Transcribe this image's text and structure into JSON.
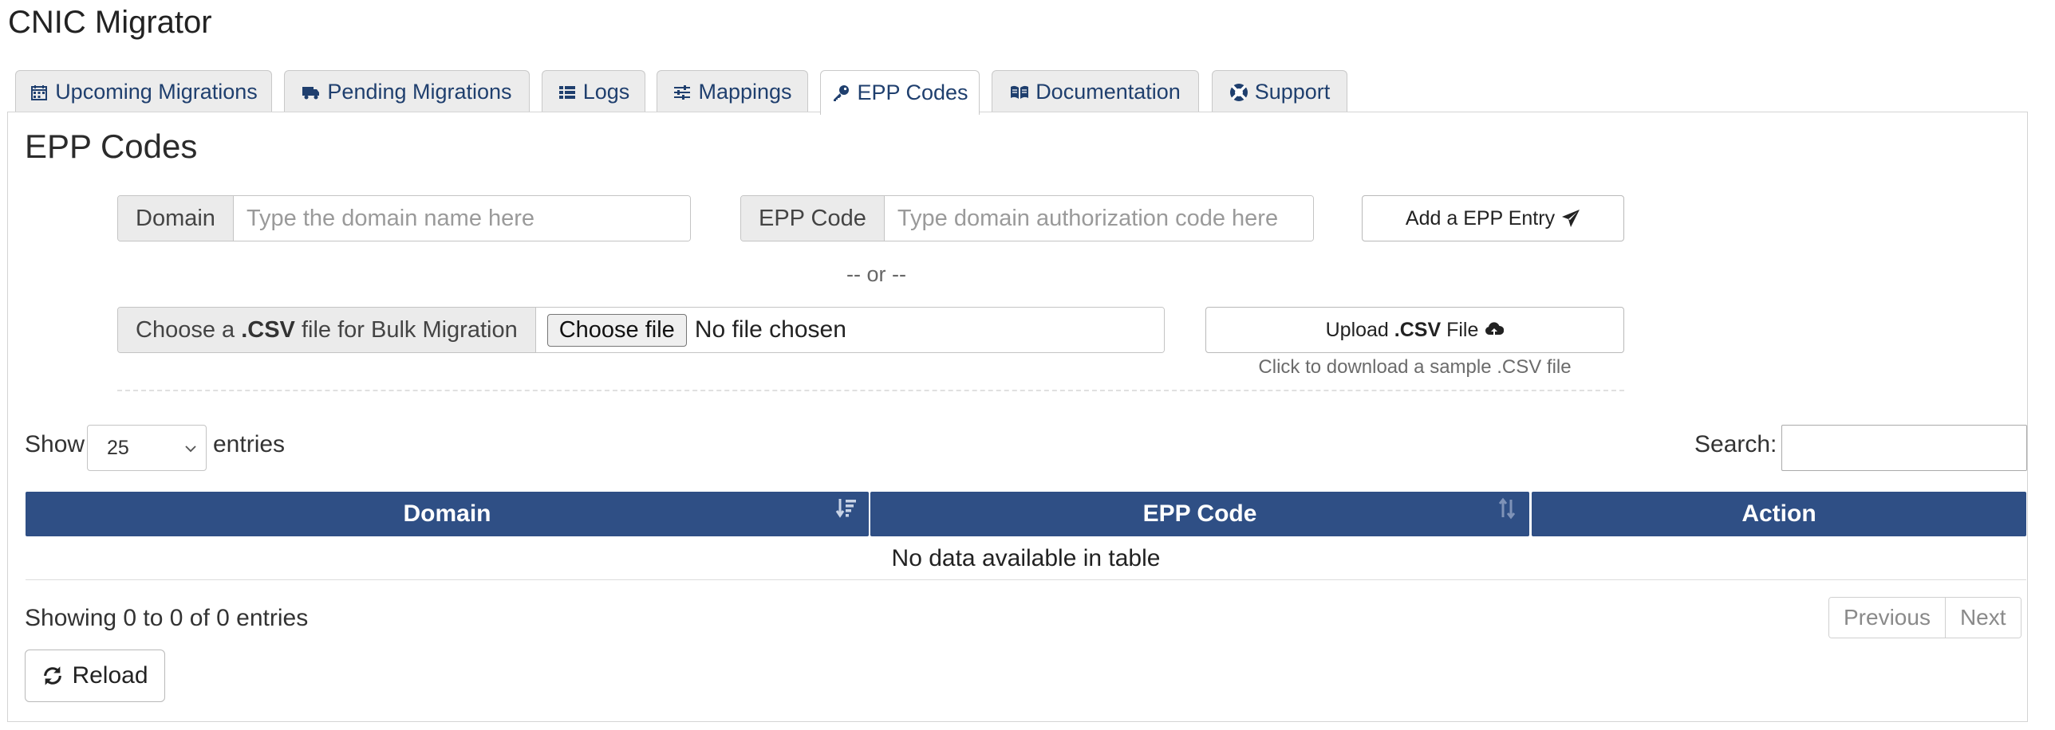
{
  "app": {
    "title": "CNIC Migrator"
  },
  "tabs": [
    {
      "label": "Upcoming Migrations",
      "icon": "calendar-icon",
      "active": false
    },
    {
      "label": "Pending Migrations",
      "icon": "truck-icon",
      "active": false
    },
    {
      "label": "Logs",
      "icon": "list-icon",
      "active": false
    },
    {
      "label": "Mappings",
      "icon": "sliders-icon",
      "active": false
    },
    {
      "label": "EPP Codes",
      "icon": "key-icon",
      "active": true
    },
    {
      "label": "Documentation",
      "icon": "book-icon",
      "active": false
    },
    {
      "label": "Support",
      "icon": "lifebuoy-icon",
      "active": false
    }
  ],
  "section": {
    "title": "EPP Codes"
  },
  "form": {
    "domain_label": "Domain",
    "domain_placeholder": "Type the domain name here",
    "domain_value": "",
    "epp_label": "EPP Code",
    "epp_placeholder": "Type domain authorization code here",
    "epp_value": "",
    "add_button": "Add a EPP Entry",
    "or_text": "-- or --",
    "csv_label_pre": "Choose a ",
    "csv_label_bold": ".CSV",
    "csv_label_post": " file for Bulk Migration",
    "choose_file": "Choose file",
    "file_status": "No file chosen",
    "upload_pre": "Upload ",
    "upload_bold": ".CSV",
    "upload_post": " File",
    "sample_link": "Click to download a sample .CSV file"
  },
  "table_controls": {
    "show": "Show",
    "entries_value": "25",
    "entries": "entries",
    "search": "Search:",
    "search_value": ""
  },
  "table": {
    "columns": [
      "Domain",
      "EPP Code",
      "Action"
    ],
    "empty": "No data available in table",
    "info": "Showing 0 to 0 of 0 entries"
  },
  "pager": {
    "previous": "Previous",
    "next": "Next"
  },
  "reload": "Reload",
  "colors": {
    "header_bg": "#2f4f85",
    "tab_text": "#1f3f6e"
  }
}
